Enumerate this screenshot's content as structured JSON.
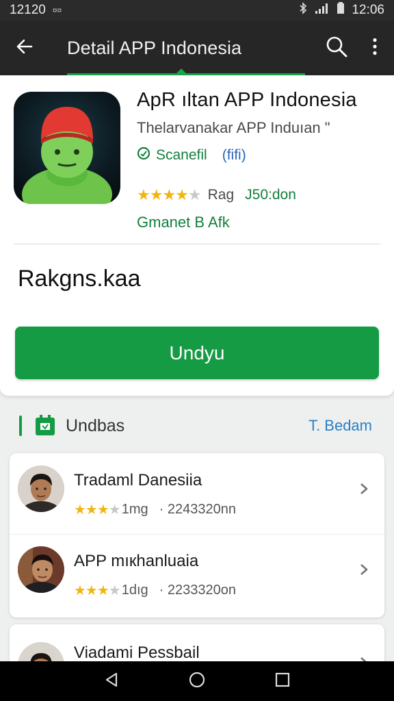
{
  "status_bar": {
    "time_left": "12120",
    "indicator": "¤¤",
    "time_right": "12:06"
  },
  "app_bar": {
    "title": "Detail APP Indonesia",
    "icons": [
      "back-arrow-icon",
      "search-icon",
      "more-vert-icon"
    ]
  },
  "app": {
    "name": "ApR ıltan APP Indonesia",
    "developer": "Thelarvanakar APP Induıan \"",
    "verified": "Scanefil",
    "category": "(fifi)",
    "rating_label": "Rag",
    "rating_value": "J50:don",
    "age": "Gmanet B Afk",
    "stars": 4.5,
    "description": "Rakgns.kaa",
    "install_label": "Undyu",
    "colors": {
      "primary": "#149b44",
      "accent_text": "#137f3c",
      "link": "#2a7fc4"
    }
  },
  "section": {
    "title": "Undbas",
    "more": "T. Bedam"
  },
  "list": [
    {
      "name": "Tradaml Danesiia",
      "size": "1mg",
      "downloads": "· 2243320nn",
      "stars": 3.5
    },
    {
      "name": "APP mıкhanluaia",
      "size": "1dıg",
      "downloads": "· 2233320on",
      "stars": 3.5
    },
    {
      "name": "Viadami Pessbail"
    }
  ],
  "nav": [
    "back-triangle-icon",
    "home-circle-icon",
    "recents-square-icon"
  ]
}
